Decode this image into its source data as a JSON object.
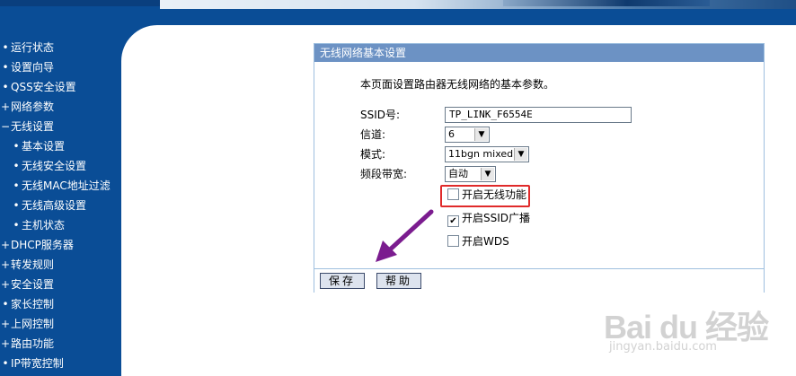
{
  "menu": [
    {
      "label": "运行状态",
      "sign": "•",
      "sub": false
    },
    {
      "label": "设置向导",
      "sign": "•",
      "sub": false
    },
    {
      "label": "QSS安全设置",
      "sign": "•",
      "sub": false
    },
    {
      "label": "网络参数",
      "sign": "+",
      "sub": false
    },
    {
      "label": "无线设置",
      "sign": "−",
      "sub": false
    },
    {
      "label": "基本设置",
      "sign": "•",
      "sub": true
    },
    {
      "label": "无线安全设置",
      "sign": "•",
      "sub": true
    },
    {
      "label": "无线MAC地址过滤",
      "sign": "•",
      "sub": true
    },
    {
      "label": "无线高级设置",
      "sign": "•",
      "sub": true
    },
    {
      "label": "主机状态",
      "sign": "•",
      "sub": true
    },
    {
      "label": "DHCP服务器",
      "sign": "+",
      "sub": false
    },
    {
      "label": "转发规则",
      "sign": "+",
      "sub": false
    },
    {
      "label": "安全设置",
      "sign": "+",
      "sub": false
    },
    {
      "label": "家长控制",
      "sign": "•",
      "sub": false
    },
    {
      "label": "上网控制",
      "sign": "+",
      "sub": false
    },
    {
      "label": "路由功能",
      "sign": "+",
      "sub": false
    },
    {
      "label": "IP带宽控制",
      "sign": "•",
      "sub": false
    }
  ],
  "panel": {
    "title": "无线网络基本设置",
    "description": "本页面设置路由器无线网络的基本参数。",
    "ssid": {
      "label": "SSID号:",
      "value": "TP_LINK_F6554E"
    },
    "channel": {
      "label": "信道:",
      "value": "6"
    },
    "mode": {
      "label": "模式:",
      "value": "11bgn mixed"
    },
    "bandwidth": {
      "label": "频段带宽:",
      "value": "自动"
    },
    "enable_wireless": {
      "label": "开启无线功能",
      "checked": false
    },
    "enable_ssid_broadcast": {
      "label": "开启SSID广播",
      "checked": true
    },
    "enable_wds": {
      "label": "开启WDS",
      "checked": false
    },
    "save_label": "保存",
    "help_label": "帮助"
  },
  "watermark": {
    "logo": "Bai du 经验",
    "url": "jingyan.baidu.com"
  },
  "colors": {
    "nav_bg": "#0a4d96",
    "panel_header": "#6c92c4",
    "highlight": "#e02a2a",
    "arrow": "#7b1c8f"
  }
}
